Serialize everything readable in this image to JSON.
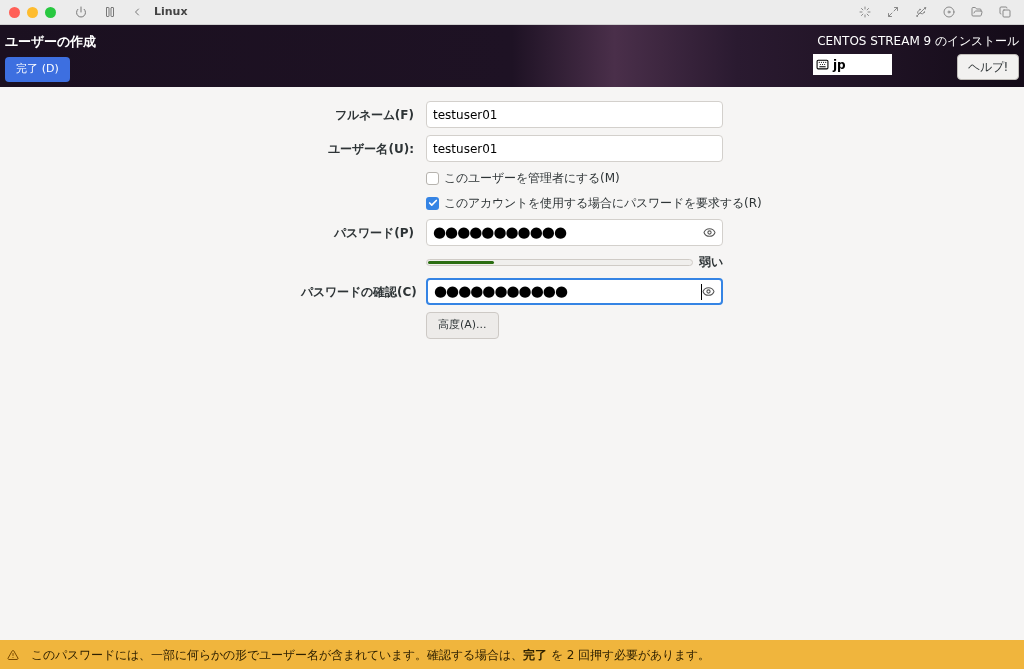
{
  "host_toolbar": {
    "title": "Linux"
  },
  "header": {
    "title": "ユーザーの作成",
    "done_button": "完了 (D)",
    "product": "CENTOS STREAM 9 のインストール",
    "keyboard": "jp",
    "help_button": "ヘルプ!"
  },
  "form": {
    "fields": [
      {
        "kind": "text",
        "label": "フルネーム(F)",
        "value": "testuser01",
        "focused": false
      },
      {
        "kind": "text",
        "label": "ユーザー名(U):",
        "value": "testuser01",
        "focused": false
      },
      {
        "kind": "checkbox",
        "label": "このユーザーを管理者にする(M)",
        "checked": false
      },
      {
        "kind": "checkbox",
        "label": "このアカウントを使用する場合にパスワードを要求する(R)",
        "checked": true
      },
      {
        "kind": "password",
        "label": "パスワード(P)",
        "value": "●●●●●●●●●●●",
        "focused": false
      },
      {
        "kind": "meter",
        "level": 0.25,
        "reading": "弱い"
      },
      {
        "kind": "password",
        "label": "パスワードの確認(C)",
        "value": "●●●●●●●●●●●",
        "focused": true
      }
    ],
    "advanced_button": "高度(A)..."
  },
  "warning": {
    "text": "このパスワードには、一部に何らかの形でユーザー名が含まれています。確認する場合は、**完了** を 2 回押す必要があります。"
  }
}
